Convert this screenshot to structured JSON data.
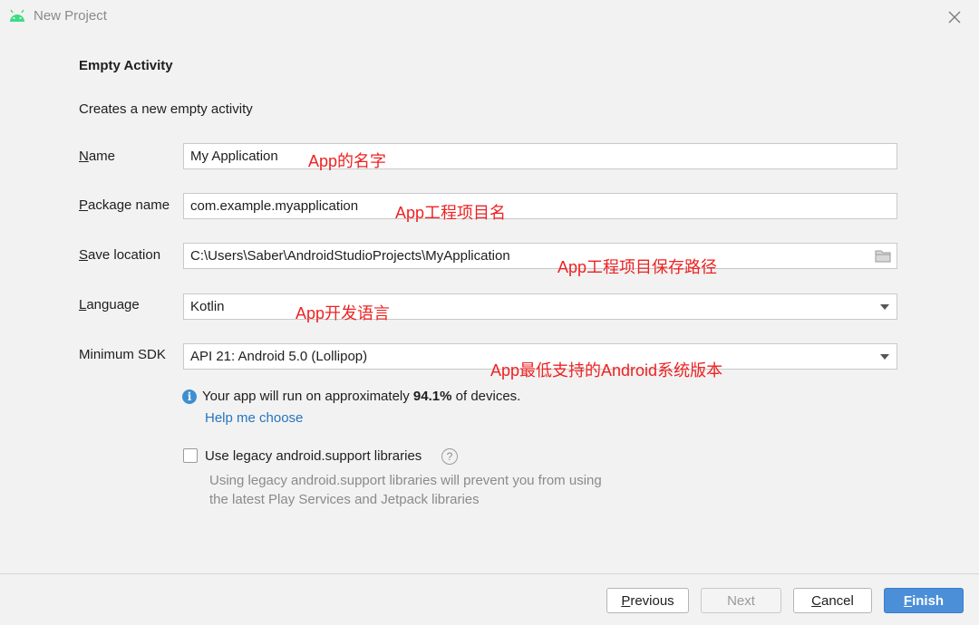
{
  "window": {
    "title": "New Project"
  },
  "header": {
    "template_title": "Empty Activity",
    "template_desc": "Creates a new empty activity"
  },
  "form": {
    "name": {
      "label_key": "N",
      "label_rest": "ame",
      "value": "My Application",
      "annotation": "App的名字"
    },
    "package": {
      "label_key": "P",
      "label_rest": "ackage name",
      "value": "com.example.myapplication",
      "annotation": "App工程项目名"
    },
    "save_location": {
      "label_key": "S",
      "label_rest": "ave location",
      "value": "C:\\Users\\Saber\\AndroidStudioProjects\\MyApplication",
      "annotation": "App工程项目保存路径"
    },
    "language": {
      "label_key": "L",
      "label_rest": "anguage",
      "value": "Kotlin",
      "annotation": "App开发语言"
    },
    "min_sdk": {
      "label": "Minimum SDK",
      "value": "API 21: Android 5.0 (Lollipop)",
      "annotation": "App最低支持的Android系统版本"
    }
  },
  "info": {
    "text_before": "Your app will run on approximately ",
    "percent": "94.1%",
    "text_after": " of devices.",
    "help_link": "Help me choose"
  },
  "legacy": {
    "checkbox_label": "Use legacy android.support libraries",
    "checked": false,
    "description_line1": "Using legacy android.support libraries will prevent you from using",
    "description_line2": "the latest Play Services and Jetpack libraries"
  },
  "buttons": {
    "previous_key": "P",
    "previous_rest": "revious",
    "next": "Next",
    "cancel_key": "C",
    "cancel_rest": "ancel",
    "finish_key": "F",
    "finish_rest": "inish"
  },
  "colors": {
    "accent": "#4a8fd8",
    "annotation": "#ee2222",
    "link": "#2675bf",
    "android_green": "#3ddc84"
  },
  "icons": {
    "app": "android-icon",
    "close": "close-icon",
    "folder": "folder-icon",
    "info": "info-icon",
    "help": "question-icon"
  }
}
